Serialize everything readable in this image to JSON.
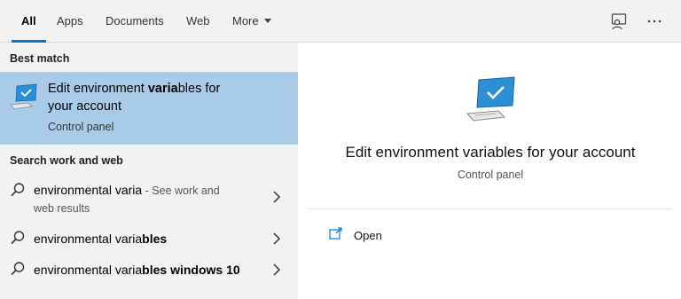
{
  "tabs": [
    {
      "label": "All",
      "active": true
    },
    {
      "label": "Apps"
    },
    {
      "label": "Documents"
    },
    {
      "label": "Web"
    },
    {
      "label": "More"
    }
  ],
  "toolbar": {
    "feedback_icon": "feedback-person-icon",
    "more_icon": "ellipsis-icon"
  },
  "best_match": {
    "section_title": "Best match",
    "title_line1_before": "Edit environment ",
    "title_line1_match": "varia",
    "title_line1_after": "bles for",
    "title_line2": "your account",
    "subtitle": "Control panel"
  },
  "search_section": {
    "title": "Search work and web",
    "results": [
      {
        "query": "environmental varia",
        "match": "",
        "suffix": " - See work and",
        "suffix_line2": "web results"
      },
      {
        "query": "environmental varia",
        "match": "bles",
        "suffix": ""
      },
      {
        "query": "environmental varia",
        "match": "bles windows 10",
        "suffix": ""
      }
    ]
  },
  "preview": {
    "title": "Edit environment variables for your account",
    "subtitle": "Control panel",
    "actions": [
      {
        "label": "Open",
        "icon": "open-icon"
      }
    ]
  },
  "colors": {
    "selected_bg": "#aacbe8",
    "accent": "#0078d4",
    "panel_bg": "#f2f2f2"
  }
}
